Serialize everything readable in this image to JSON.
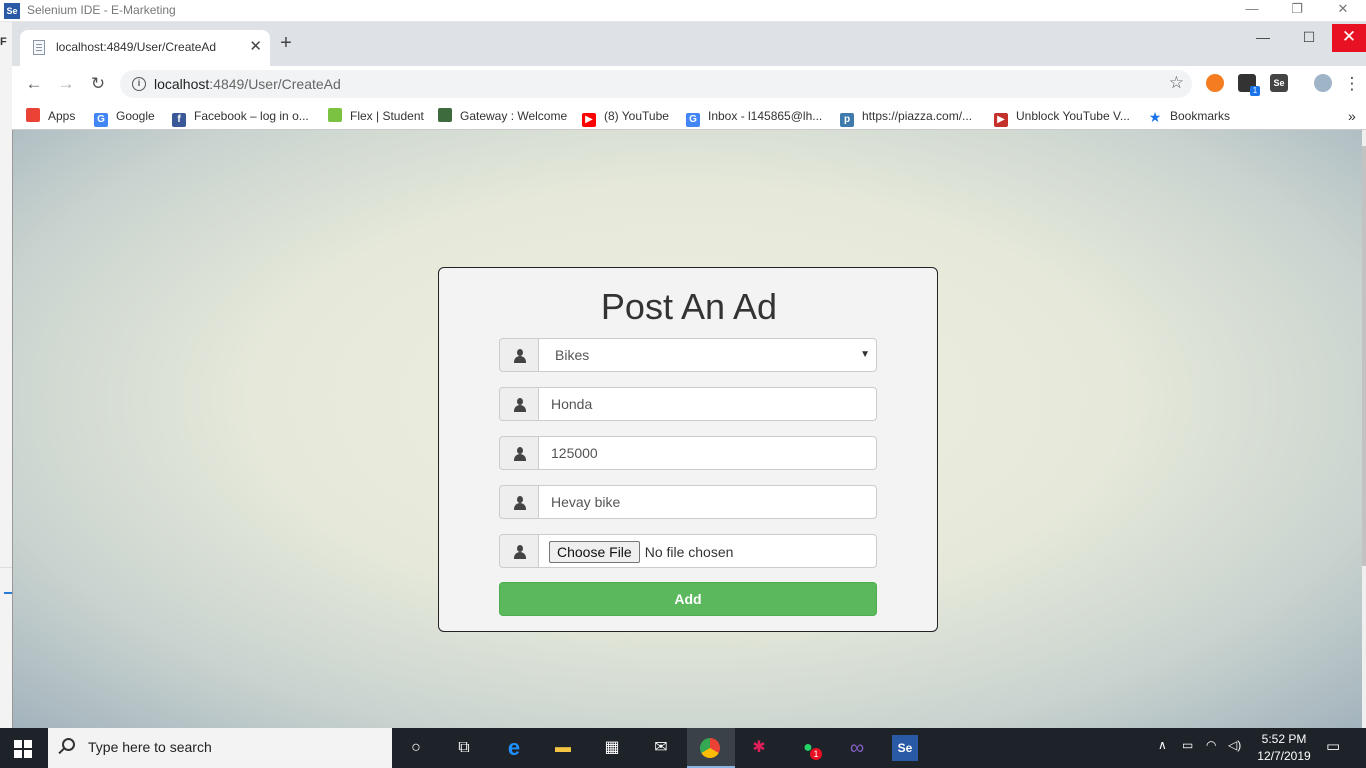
{
  "ide_window": {
    "title": "Selenium IDE - E-Marketing",
    "logo": "Se",
    "side_letter": "F"
  },
  "browser": {
    "tab": {
      "title": "localhost:4849/User/CreateAd",
      "close": "✕"
    },
    "new_tab": "+",
    "url": {
      "host": "localhost",
      "rest": ":4849/User/CreateAd"
    },
    "bookmarks": [
      {
        "label": "Apps",
        "icon": "apps-grid-icon",
        "color": "#ea4335"
      },
      {
        "label": "Google",
        "icon": "google-icon",
        "color": "#4285f4"
      },
      {
        "label": "Facebook – log in o...",
        "icon": "facebook-icon",
        "color": "#3b5998"
      },
      {
        "label": "Flex | Student",
        "icon": "flex-icon",
        "color": "#7cc242"
      },
      {
        "label": "Gateway : Welcome",
        "icon": "gateway-icon",
        "color": "#3d6b3d"
      },
      {
        "label": "(8) YouTube",
        "icon": "youtube-icon",
        "color": "#ff0000"
      },
      {
        "label": "Inbox - l145865@lh...",
        "icon": "google-icon",
        "color": "#4285f4"
      },
      {
        "label": "https://piazza.com/...",
        "icon": "piazza-icon",
        "color": "#3e7aab"
      },
      {
        "label": "Unblock YouTube V...",
        "icon": "youtube-icon",
        "color": "#c4302b"
      },
      {
        "label": "Bookmarks",
        "icon": "star-icon",
        "color": "#1a73e8"
      }
    ],
    "extension_badge": "1",
    "ext_se": "Se"
  },
  "form": {
    "title": "Post An Ad",
    "category": "Bikes",
    "name": "Honda",
    "price": "125000",
    "description": "Hevay bike",
    "file_button": "Choose File",
    "file_status": "No file chosen",
    "submit": "Add"
  },
  "taskbar": {
    "search_placeholder": "Type here to search",
    "time": "5:52 PM",
    "date": "12/7/2019",
    "whatsapp_badge": "1",
    "selenium": "Se"
  }
}
